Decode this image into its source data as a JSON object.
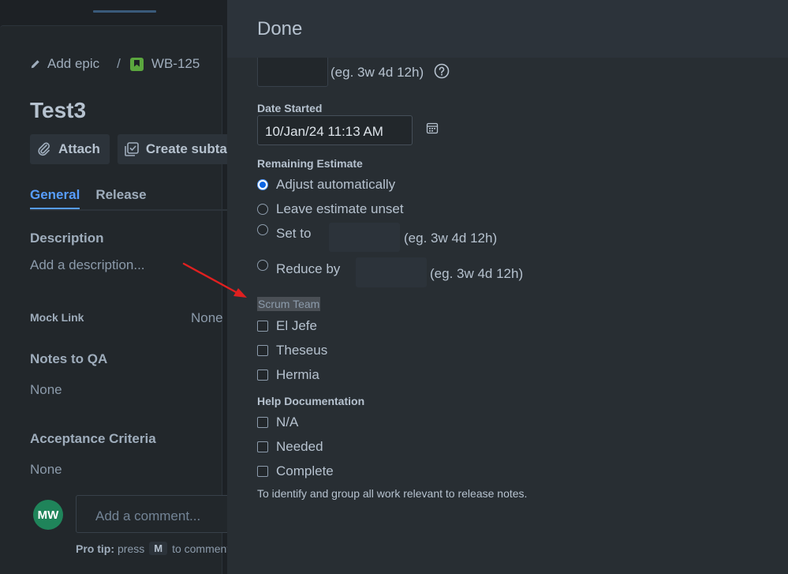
{
  "issue": {
    "add_epic": "Add epic",
    "separator": "/",
    "key": "WB-125",
    "title": "Test3",
    "attach_label": "Attach",
    "create_subtask_label": "Create subtas",
    "tabs": [
      {
        "label": "General"
      },
      {
        "label": "Release"
      }
    ],
    "description_heading": "Description",
    "description_placeholder": "Add a description...",
    "mock_link_label": "Mock Link",
    "mock_link_value": "None",
    "notes_to_qa_heading": "Notes to QA",
    "notes_to_qa_value": "None",
    "acceptance_heading": "Acceptance Criteria",
    "acceptance_value": "None",
    "avatar_initials": "MW",
    "comment_placeholder": "Add a comment...",
    "protip_bold": "Pro tip:",
    "protip_press": "press",
    "protip_key": "M",
    "protip_rest": "to comment"
  },
  "dialog": {
    "title": "Done",
    "time_spent_hint": "(eg. 3w 4d 12h)",
    "date_started_label": "Date Started",
    "date_started_value": "10/Jan/24 11:13 AM",
    "remaining_label": "Remaining Estimate",
    "remaining_options": [
      {
        "label": "Adjust automatically",
        "checked": true
      },
      {
        "label": "Leave estimate unset",
        "checked": false
      },
      {
        "label": "Set to",
        "hint": "(eg. 3w 4d 12h)",
        "checked": false
      },
      {
        "label": "Reduce by",
        "hint": "(eg. 3w 4d 12h)",
        "checked": false
      }
    ],
    "scrum_team_label": "Scrum Team",
    "scrum_team_options": [
      {
        "label": "El Jefe",
        "checked": false
      },
      {
        "label": "Theseus",
        "checked": false
      },
      {
        "label": "Hermia",
        "checked": false
      }
    ],
    "help_doc_label": "Help Documentation",
    "help_doc_options": [
      {
        "label": "N/A",
        "checked": false
      },
      {
        "label": "Needed",
        "checked": false
      },
      {
        "label": "Complete",
        "checked": false
      }
    ],
    "help_doc_description": "To identify and group all work relevant to release notes."
  },
  "colors": {
    "accent": "#579dff",
    "annotation_arrow": "#e02020",
    "avatar_bg": "#1f845a",
    "story_badge": "#5ba63e"
  }
}
